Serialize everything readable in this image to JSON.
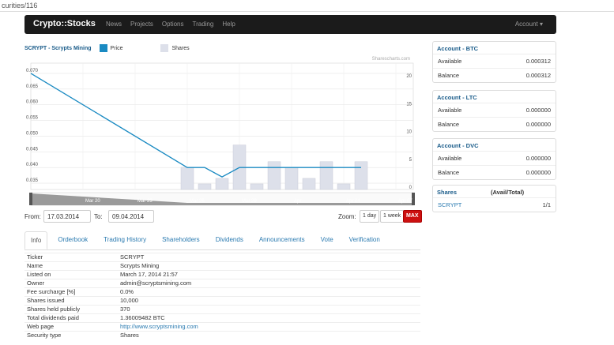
{
  "browser": {
    "url_fragment": "curities/116"
  },
  "navbar": {
    "brand": "Crypto::Stocks",
    "links": [
      "News",
      "Projects",
      "Options",
      "Trading",
      "Help"
    ],
    "account": "Account ▾"
  },
  "chart": {
    "title": "SCRYPT - Scrypts Mining",
    "legend_price": "Price",
    "legend_shares": "Shares",
    "corner_note": "Sharescharts.com",
    "price_color": "#1a8ac2",
    "shares_color": "#dde0ea"
  },
  "chart_data": {
    "type": "line",
    "series": [
      {
        "name": "Price",
        "values": [
          0.07,
          0.04,
          0.04,
          0.037,
          0.04,
          0.04,
          0.04,
          0.04,
          0.04,
          0.04,
          0.04,
          0.04
        ]
      },
      {
        "name": "Shares",
        "values": [
          0,
          4,
          1,
          2,
          8,
          1,
          5,
          4,
          2,
          5,
          1,
          5
        ]
      }
    ],
    "x_positions_days": [
      17,
      26,
      27,
      28,
      29,
      30,
      31,
      32,
      33,
      34,
      35,
      36
    ],
    "price_ticks": [
      "0.070",
      "0.065",
      "0.060",
      "0.055",
      "0.050",
      "0.045",
      "0.040",
      "0.035"
    ],
    "shares_ticks": [
      "20",
      "15",
      "10",
      "5",
      "0"
    ],
    "ylim_price": [
      0.033,
      0.072
    ],
    "ylim_shares": [
      0,
      22
    ],
    "nav_labels": [
      "Mar 20",
      "Mar 23",
      "Mar 26",
      "Mar 29",
      "Apr",
      "Apr 04",
      "Apr 07"
    ],
    "grid": true
  },
  "range": {
    "from_label": "From:",
    "from_value": "17.03.2014",
    "to_label": "To:",
    "to_value": "09.04.2014",
    "zoom_label": "Zoom:",
    "zoom_day": "1 day",
    "zoom_week": "1 week",
    "zoom_max": "MAX"
  },
  "tabs": [
    "Info",
    "Orderbook",
    "Trading History",
    "Shareholders",
    "Dividends",
    "Announcements",
    "Vote",
    "Verification"
  ],
  "info": [
    {
      "k": "Ticker",
      "v": "SCRYPT"
    },
    {
      "k": "Name",
      "v": "Scrypts Mining"
    },
    {
      "k": "Listed on",
      "v": "March 17, 2014 21:57"
    },
    {
      "k": "Owner",
      "v": "admin@scryptsmining.com"
    },
    {
      "k": "Fee surcharge [%]",
      "v": "0.0%"
    },
    {
      "k": "Shares issued",
      "v": "10,000"
    },
    {
      "k": "Shares held publicly",
      "v": "370"
    },
    {
      "k": "Total dividends paid",
      "v": "1.36009482 BTC"
    },
    {
      "k": "Web page",
      "v": "http://www.scryptsmining.com"
    },
    {
      "k": "Security type",
      "v": "Shares"
    }
  ],
  "accounts": [
    {
      "title": "Account - BTC",
      "available_label": "Available",
      "available": "0.000312",
      "balance_label": "Balance",
      "balance": "0.000312"
    },
    {
      "title": "Account - LTC",
      "available_label": "Available",
      "available": "0.000000",
      "balance_label": "Balance",
      "balance": "0.000000"
    },
    {
      "title": "Account - DVC",
      "available_label": "Available",
      "available": "0.000000",
      "balance_label": "Balance",
      "balance": "0.000000"
    }
  ],
  "shares_panel": {
    "title": "Shares",
    "col": "(Avail/Total)",
    "ticker": "SCRYPT",
    "value": "1/1"
  }
}
